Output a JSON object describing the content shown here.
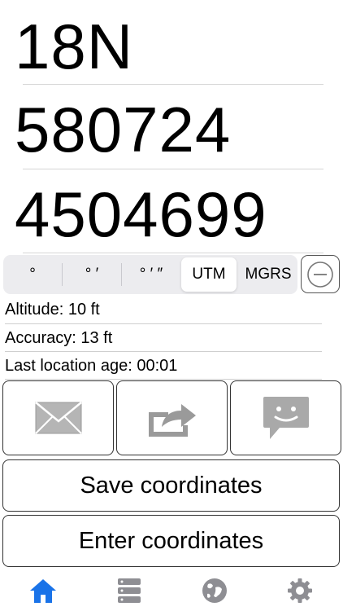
{
  "coords": {
    "zone": "18N",
    "easting": "580724",
    "northing": "4504699"
  },
  "format_segments": [
    {
      "label": "°"
    },
    {
      "label": "° ′"
    },
    {
      "label": "° ′ ″"
    },
    {
      "label": "UTM",
      "selected": true
    },
    {
      "label": "MGRS"
    }
  ],
  "info": {
    "altitude": "Altitude: 10 ft",
    "accuracy": "Accuracy: 13 ft",
    "age": "Last location age: 00:01"
  },
  "share_icons": [
    "mail-icon",
    "share-export-icon",
    "message-icon"
  ],
  "buttons": {
    "save": "Save coordinates",
    "enter": "Enter coordinates"
  },
  "tabbar": [
    {
      "icon": "home-icon",
      "active": true
    },
    {
      "icon": "list-icon"
    },
    {
      "icon": "globe-icon"
    },
    {
      "icon": "gear-icon"
    }
  ],
  "colors": {
    "accent": "#1a73e8",
    "icon_gray": "#8e8e93"
  }
}
